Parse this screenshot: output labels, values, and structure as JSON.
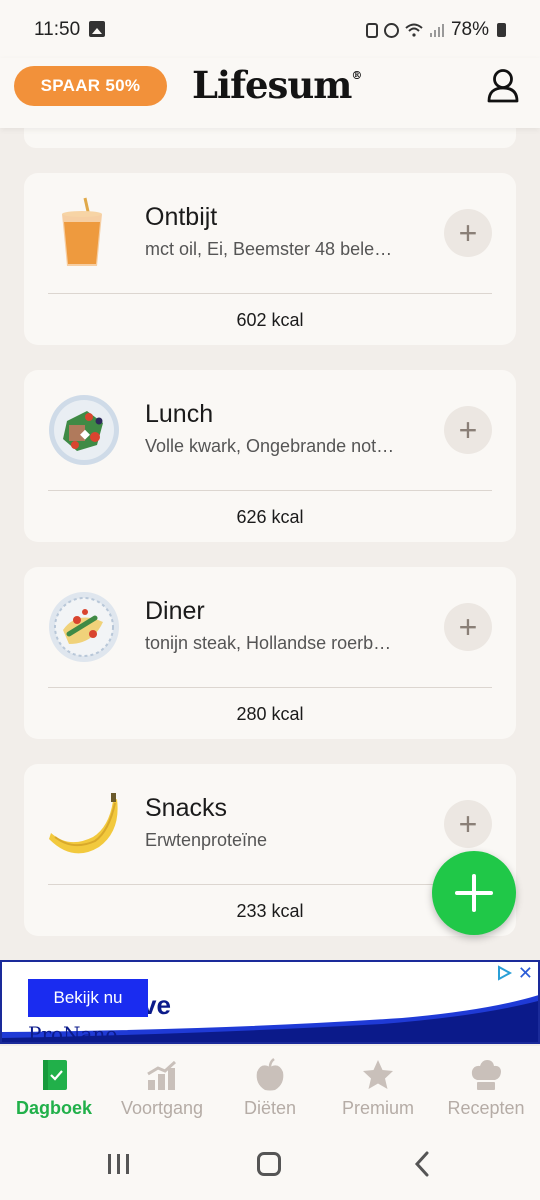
{
  "status_bar": {
    "time": "11:50",
    "battery": "78%"
  },
  "header": {
    "promo_label": "SPAAR 50%",
    "logo_text": "Lifesum",
    "logo_mark": "®"
  },
  "meals": [
    {
      "name": "Ontbijt",
      "items": "mct oil, Ei, Beemster 48 bele…",
      "kcal": "602 kcal",
      "icon": "juice-icon"
    },
    {
      "name": "Lunch",
      "items": "Volle kwark, Ongebrande not…",
      "kcal": "626 kcal",
      "icon": "salad-icon"
    },
    {
      "name": "Diner",
      "items": "tonijn steak, Hollandse roerb…",
      "kcal": "280 kcal",
      "icon": "pasta-icon"
    },
    {
      "name": "Snacks",
      "items": "Erwtenproteïne",
      "kcal": "233 kcal",
      "icon": "banana-icon"
    }
  ],
  "ad": {
    "cta": "Bekijk nu",
    "brand_fragment": "ve",
    "sub_fragment": "ProNano"
  },
  "nav": {
    "items": [
      {
        "label": "Dagboek",
        "icon": "diary-icon",
        "active": true
      },
      {
        "label": "Voortgang",
        "icon": "progress-chart-icon"
      },
      {
        "label": "Diëten",
        "icon": "apple-icon"
      },
      {
        "label": "Premium",
        "icon": "star-icon"
      },
      {
        "label": "Recepten",
        "icon": "chef-hat-icon"
      }
    ]
  },
  "colors": {
    "accent_green": "#21b04a",
    "promo_orange": "#f2913a",
    "fab_green": "#20c848",
    "background": "#f2eeea"
  }
}
